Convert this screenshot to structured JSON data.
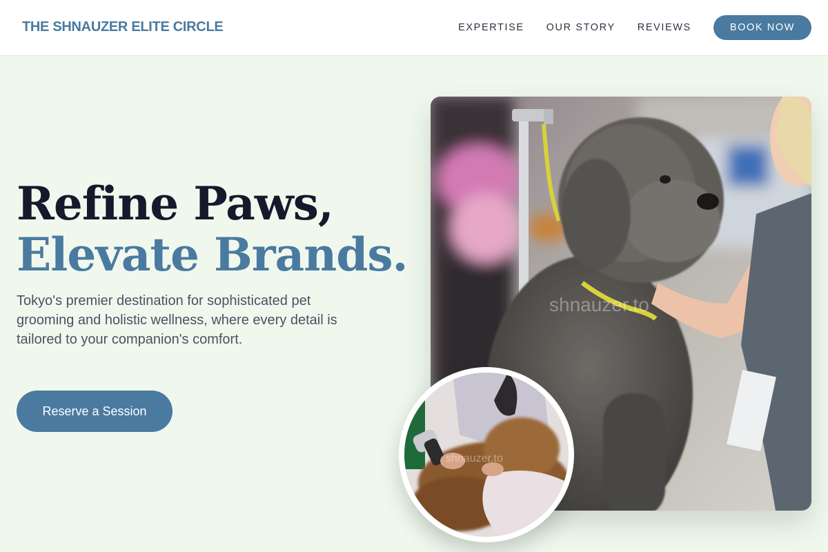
{
  "header": {
    "brand": "THE SHNAUZER ELITE CIRCLE",
    "nav": [
      {
        "label": "EXPERTISE"
      },
      {
        "label": "OUR STORY"
      },
      {
        "label": "REVIEWS"
      }
    ],
    "cta_label": "BOOK NOW"
  },
  "hero": {
    "title_line1": "Refine Paws,",
    "title_line2": "Elevate Brands.",
    "description": "Tokyo's premier destination for sophisticated pet grooming and holistic wellness, where every detail is tailored to your companion's comfort.",
    "cta_label": "Reserve a Session"
  },
  "images": {
    "main_watermark": "shnauzer.to",
    "circle_watermark": "shnauzer.to"
  },
  "colors": {
    "accent": "#4a7aa0",
    "heading": "#121a2b",
    "background": "#f0f8ee",
    "body_text": "#4a5260"
  }
}
